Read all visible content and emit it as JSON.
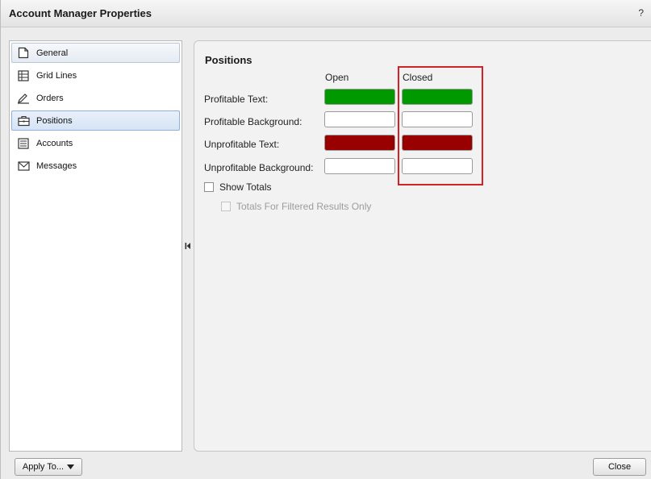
{
  "dialog": {
    "title": "Account Manager Properties",
    "help_label": "?"
  },
  "sidebar": {
    "items": [
      {
        "label": "General",
        "icon": "page-icon"
      },
      {
        "label": "Grid Lines",
        "icon": "grid-icon"
      },
      {
        "label": "Orders",
        "icon": "pencil-icon"
      },
      {
        "label": "Positions",
        "icon": "briefcase-icon"
      },
      {
        "label": "Accounts",
        "icon": "list-icon"
      },
      {
        "label": "Messages",
        "icon": "envelope-icon"
      }
    ],
    "selected": "Positions"
  },
  "panel": {
    "title": "Positions",
    "columns": {
      "open": "Open",
      "closed": "Closed"
    },
    "rows": [
      {
        "label": "Profitable Text:",
        "open_color": "#009900",
        "closed_color": "#009900"
      },
      {
        "label": "Profitable Background:",
        "open_color": "#ffffff",
        "closed_color": "#ffffff"
      },
      {
        "label": "Unprofitable Text:",
        "open_color": "#990000",
        "closed_color": "#990000"
      },
      {
        "label": "Unprofitable Background:",
        "open_color": "#ffffff",
        "closed_color": "#ffffff"
      }
    ],
    "show_totals": {
      "label": "Show Totals",
      "checked": false
    },
    "filtered_only": {
      "label": "Totals For Filtered Results Only",
      "checked": false,
      "enabled": false
    },
    "highlight_color": "#d42027"
  },
  "footer": {
    "apply_label": "Apply To...",
    "close_label": "Close"
  }
}
